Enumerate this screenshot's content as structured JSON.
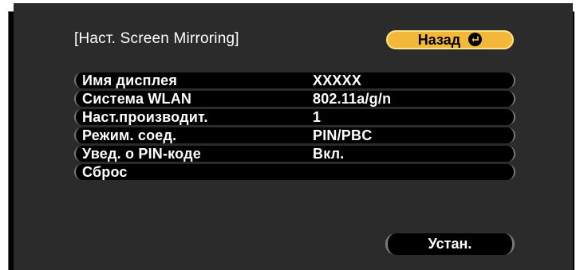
{
  "title": "[Наст. Screen Mirroring]",
  "back_button": {
    "label": "Назад",
    "icon": "enter-icon"
  },
  "settings": [
    {
      "label": "Имя дисплея",
      "value": "XXXXX"
    },
    {
      "label": "Система WLAN",
      "value": "802.11a/g/n"
    },
    {
      "label": "Наст.производит.",
      "value": " 1"
    },
    {
      "label": "Режим. соед.",
      "value": "PIN/PBC"
    },
    {
      "label": "Увед. о PIN-коде",
      "value": "Вкл."
    },
    {
      "label": "Сброс",
      "value": ""
    }
  ],
  "set_button": {
    "label": "Устан."
  },
  "colors": {
    "panel": "#2b2b2b",
    "accent": "#f3b83a",
    "row": "#000000",
    "text": "#ffffff"
  }
}
